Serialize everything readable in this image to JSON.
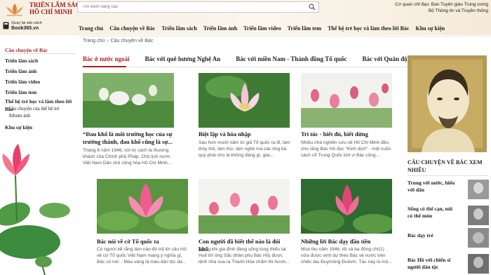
{
  "header": {
    "logo_title": "TRIỂN LÃM SÁCH HỒ CHÍ MINH",
    "search_placeholder": "Tìm kiếm nâng cao",
    "gov_line1": "Cơ quan chỉ đạo: Ban Tuyên giáo Trung ương",
    "gov_line2": "Bộ Thông tin và Truyền thông",
    "book_line1": "Quay lại sàn sách",
    "book_line2": "Book365.vn"
  },
  "nav": {
    "items": [
      "Trang chủ",
      "Câu chuyện về Bác",
      "Triển lãm sách",
      "Triển lãm ảnh",
      "Triển lãm video",
      "Triển lãm tem",
      "Thế hệ trẻ học và làm theo lời Bác",
      "Khu sự kiện"
    ]
  },
  "breadcrumb": {
    "home": "Trang chủ",
    "current": "Câu chuyện về Bác",
    "sep": "›"
  },
  "sidebar": {
    "items": [
      {
        "label": "Câu chuyện về Bác"
      },
      {
        "label": "Triển lãm sách"
      },
      {
        "label": "Triển lãm ảnh"
      },
      {
        "label": "Triển lãm video"
      },
      {
        "label": "Triển lãm tem"
      },
      {
        "label": "Thế hệ trẻ học và làm theo lời Bác"
      }
    ],
    "subs": [
      "Câu chuyện của thế hệ trẻ",
      "Album ảnh"
    ],
    "events": "Khu sự kiện"
  },
  "tabs": [
    "Bác ở nước ngoài",
    "Bác với quê hương Nghệ An",
    "Bác với miền Nam - Thành đồng Tổ quốc",
    "Bác với Quân đội và Công an"
  ],
  "cards": [
    {
      "title": "“Đau khổ là môi trường học của sự trưởng thành, đau khổ cũng là sự...",
      "desc": "Tháng 6 năm 1946, với tư cách là thượng khách của Chính phủ Pháp, Chủ tịch nước Việt Nam Dân chủ cộng hòa Hồ Chí Minh..."
    },
    {
      "title": "Biệt lập và hòa nhập",
      "desc": "Sau hơn mười năm từ giã Tổ quốc ra đi, làm thủy thủ, làm thợ, làm nghề mà các ông bà quý phái cho là không đáng gì, giai..."
    },
    {
      "title": "Tri túc - biết đủ, biết dừng",
      "desc": "Nhiều nhà nghiên cứu về Hồ Chí Minh đều cho rằng Bác Hồ đọc \"Kinh dịch\" - một cuốn sách cổ Trung Quốc bởi vì Bác cũng..."
    },
    {
      "title": "Bác nói về cờ Tổ quốc ta",
      "desc": "Có người kể rằng làm nào đó trả lời câu hỏi về cờ Tổ quốc Việt Nam mang ý nghĩa gì, Bác có nói: - Màu vàng là màu dân tộc da..."
    },
    {
      "title": "Con người đã biết thế nào là đói khổ",
      "desc": "Trong khi gia đình đang sống túng thiếu tại Huế thì ông Sắc (thân phụ Bác Hồ) được lệnh nhà vua ra Thanh Hóa chấm thi hươn..."
    },
    {
      "title": "Những lời Bác dạy đầu tiên",
      "desc": "Mùa thu năm 1946, tôi và ba đồng chí(1) nữa được vinh dự theo Bác về nước trên chiếc tàu Đuymông Đuêvin. Tàu này là mộ..."
    }
  ],
  "right": {
    "title": "Câu chuyện về Bác xem nhiều",
    "items": [
      "Trung với nước, hiếu với dân",
      "Sống có thể cạn, núi có thể mòn",
      "Bác dạy trẻ",
      "Bác Hồ với chiến sĩ người dân tộc"
    ]
  },
  "colors": {
    "accent": "#b01e1e",
    "header_bg": "#f7efe2",
    "portrait_bg": "#b59a55"
  }
}
